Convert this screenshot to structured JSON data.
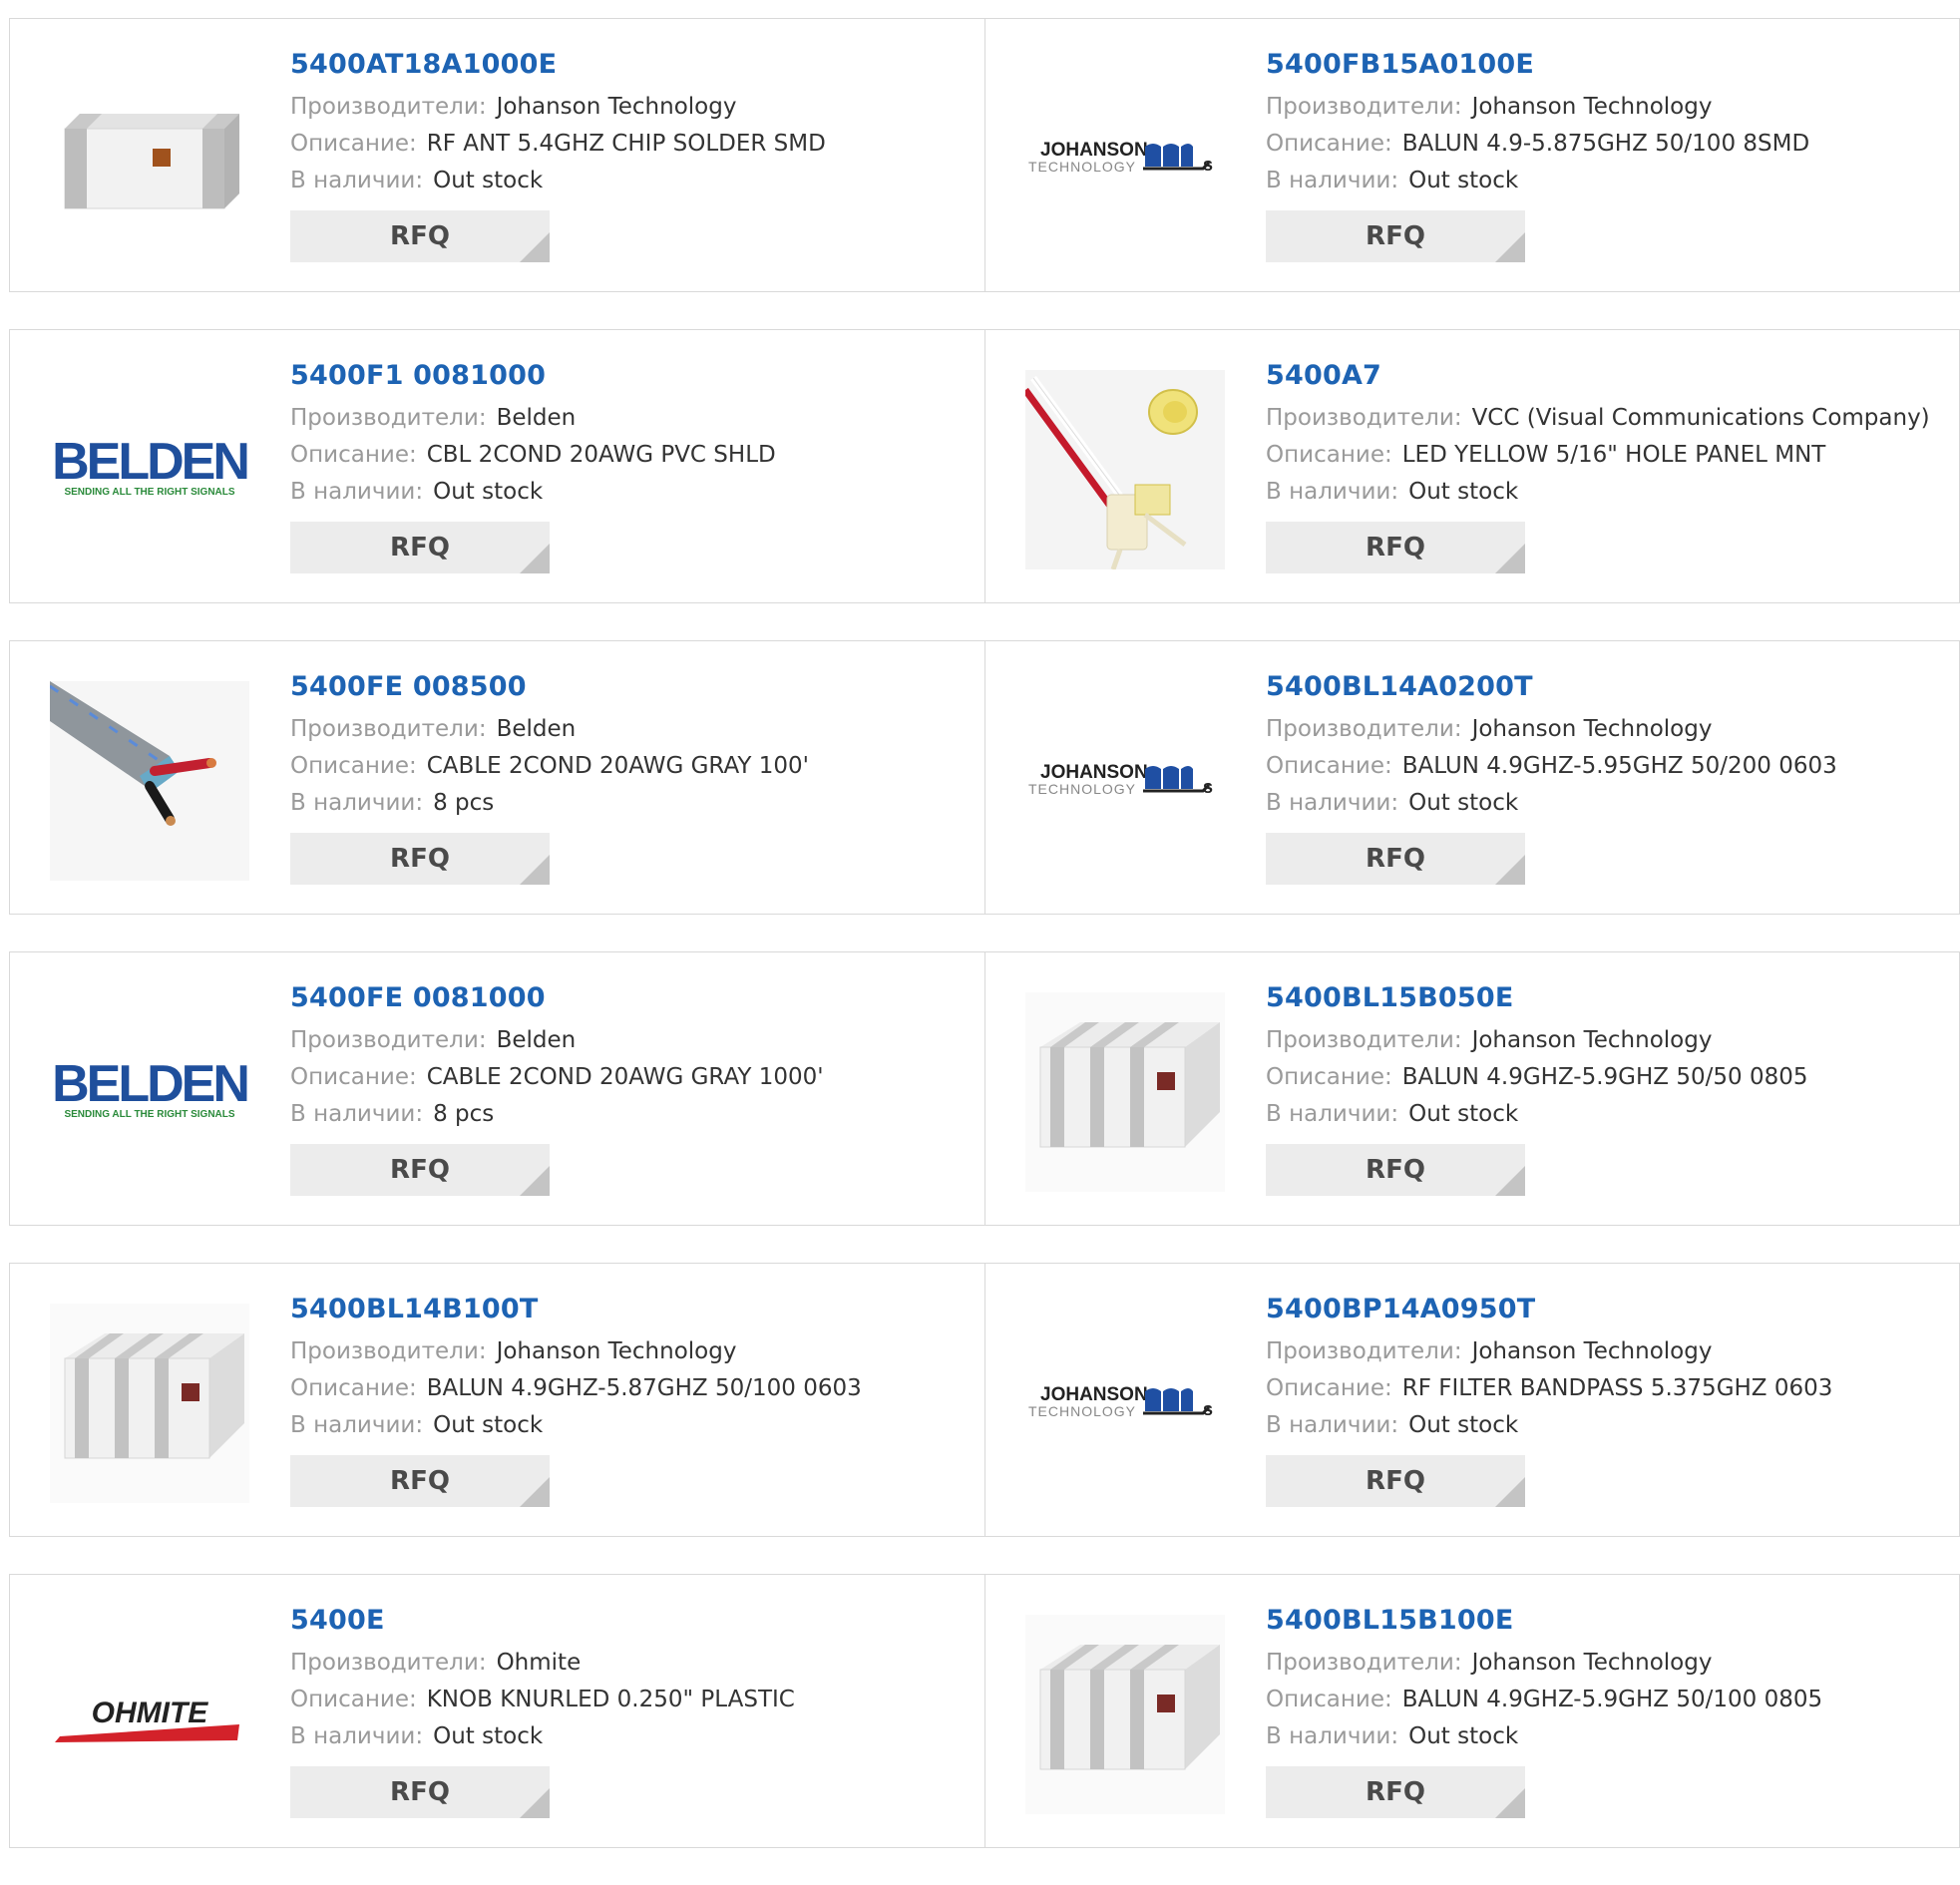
{
  "labels": {
    "manufacturer": "Производители:",
    "description": "Описание:",
    "stock": "В наличии:",
    "rfq": "RFQ"
  },
  "colors": {
    "link": "#1d63b3",
    "label": "#9a9a9a",
    "value": "#333333",
    "button_bg": "#ececec",
    "border": "#d9d9d9"
  },
  "products": [
    {
      "part": "5400AT18A1000E",
      "manufacturer": "Johanson Technology",
      "description": "RF ANT 5.4GHZ CHIP SOLDER SMD",
      "stock": "Out stock",
      "image": "chip-antenna-icon"
    },
    {
      "part": "5400FB15A0100E",
      "manufacturer": "Johanson Technology",
      "description": "BALUN 4.9-5.875GHZ 50/100 8SMD",
      "stock": "Out stock",
      "image": "johanson-logo",
      "logo_text": [
        "JOHANSON",
        "TECHNOLOGY"
      ]
    },
    {
      "part": "5400F1 0081000",
      "manufacturer": "Belden",
      "description": "CBL 2COND 20AWG PVC SHLD",
      "stock": "Out stock",
      "image": "belden-logo",
      "logo_text": [
        "BELDEN",
        "SENDING ALL THE RIGHT SIGNALS"
      ]
    },
    {
      "part": "5400A7",
      "manufacturer": "VCC (Visual Communications Company)",
      "description": "LED YELLOW 5/16\" HOLE PANEL MNT",
      "stock": "Out stock",
      "image": "led-panel-icon"
    },
    {
      "part": "5400FE 008500",
      "manufacturer": "Belden",
      "description": "CABLE 2COND 20AWG GRAY 100'",
      "stock": "8 pcs",
      "image": "cable-icon"
    },
    {
      "part": "5400BL14A0200T",
      "manufacturer": "Johanson Technology",
      "description": "BALUN 4.9GHZ-5.95GHZ 50/200 0603",
      "stock": "Out stock",
      "image": "johanson-logo",
      "logo_text": [
        "JOHANSON",
        "TECHNOLOGY"
      ]
    },
    {
      "part": "5400FE 0081000",
      "manufacturer": "Belden",
      "description": "CABLE 2COND 20AWG GRAY 1000'",
      "stock": "8 pcs",
      "image": "belden-logo",
      "logo_text": [
        "BELDEN",
        "SENDING ALL THE RIGHT SIGNALS"
      ]
    },
    {
      "part": "5400BL15B050E",
      "manufacturer": "Johanson Technology",
      "description": "BALUN 4.9GHZ-5.9GHZ 50/50 0805",
      "stock": "Out stock",
      "image": "balun-chip-icon"
    },
    {
      "part": "5400BL14B100T",
      "manufacturer": "Johanson Technology",
      "description": "BALUN 4.9GHZ-5.87GHZ 50/100 0603",
      "stock": "Out stock",
      "image": "balun-chip-icon"
    },
    {
      "part": "5400BP14A0950T",
      "manufacturer": "Johanson Technology",
      "description": "RF FILTER BANDPASS 5.375GHZ 0603",
      "stock": "Out stock",
      "image": "johanson-logo",
      "logo_text": [
        "JOHANSON",
        "TECHNOLOGY"
      ]
    },
    {
      "part": "5400E",
      "manufacturer": "Ohmite",
      "description": "KNOB KNURLED 0.250\" PLASTIC",
      "stock": "Out stock",
      "image": "ohmite-logo",
      "logo_text": [
        "OHMITE"
      ]
    },
    {
      "part": "5400BL15B100E",
      "manufacturer": "Johanson Technology",
      "description": "BALUN 4.9GHZ-5.9GHZ 50/100 0805",
      "stock": "Out stock",
      "image": "balun-chip-icon"
    }
  ]
}
